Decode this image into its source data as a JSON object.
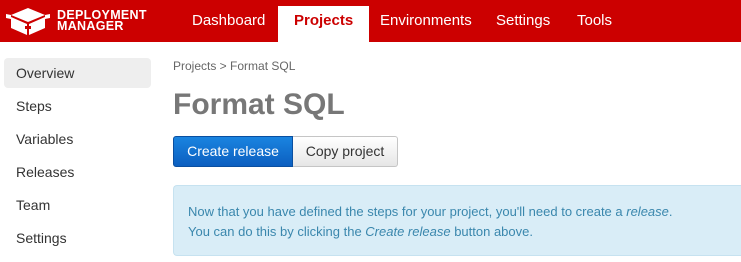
{
  "brand": {
    "line1": "DEPLOYMENT",
    "line2": "MANAGER",
    "icon": "logo-box-icon"
  },
  "nav": {
    "items": [
      {
        "label": "Dashboard",
        "active": false
      },
      {
        "label": "Projects",
        "active": true
      },
      {
        "label": "Environments",
        "active": false
      },
      {
        "label": "Settings",
        "active": false
      },
      {
        "label": "Tools",
        "active": false
      }
    ]
  },
  "sidebar": {
    "items": [
      {
        "label": "Overview",
        "active": true
      },
      {
        "label": "Steps",
        "active": false
      },
      {
        "label": "Variables",
        "active": false
      },
      {
        "label": "Releases",
        "active": false
      },
      {
        "label": "Team",
        "active": false
      },
      {
        "label": "Settings",
        "active": false
      }
    ]
  },
  "main": {
    "breadcrumb": "Projects > Format SQL",
    "title": "Format SQL",
    "buttons": {
      "create_release": "Create release",
      "copy_project": "Copy project"
    },
    "alert": {
      "line1_prefix": "Now that you have defined the steps for your project, you'll need to create a ",
      "line1_em": "release",
      "line1_suffix": ".",
      "line2_prefix": "You can do this by clicking the ",
      "line2_em": "Create release",
      "line2_suffix": " button above."
    }
  },
  "colors": {
    "brand_red": "#cc0000",
    "primary_blue": "#0c5fc0",
    "alert_bg": "#d9edf7",
    "alert_text": "#3a87ad"
  }
}
